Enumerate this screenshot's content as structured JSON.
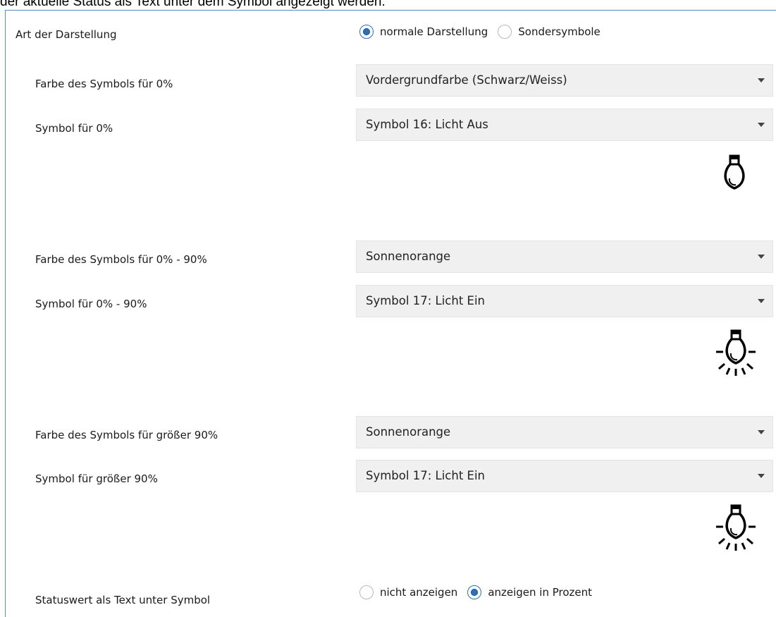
{
  "intro_text": "der aktuelle Status als Text unter dem Symbol angezeigt werden:",
  "display_mode": {
    "label": "Art der Darstellung",
    "options": [
      {
        "label": "normale Darstellung",
        "selected": true
      },
      {
        "label": "Sondersymbole",
        "selected": false
      }
    ]
  },
  "groups": [
    {
      "color_label": "Farbe des Symbols für 0%",
      "color_value": "Vordergrundfarbe (Schwarz/Weiss)",
      "symbol_label": "Symbol für 0%",
      "symbol_value": "Symbol 16: Licht Aus",
      "icon": "bulb-off-icon"
    },
    {
      "color_label": "Farbe des Symbols für 0% - 90%",
      "color_value": "Sonnenorange",
      "symbol_label": "Symbol für 0% - 90%",
      "symbol_value": "Symbol 17: Licht Ein",
      "icon": "bulb-on-icon"
    },
    {
      "color_label": "Farbe des Symbols für größer 90%",
      "color_value": "Sonnenorange",
      "symbol_label": "Symbol für größer 90%",
      "symbol_value": "Symbol 17: Licht Ein",
      "icon": "bulb-on-icon"
    }
  ],
  "status_text": {
    "label": "Statuswert als Text unter Symbol",
    "options": [
      {
        "label": "nicht anzeigen",
        "selected": false
      },
      {
        "label": "anzeigen in Prozent",
        "selected": true
      }
    ]
  },
  "colors": {
    "accent": "#2f6fb5",
    "panel_border": "#5b8bc4",
    "select_bg": "#f0f0f0"
  }
}
